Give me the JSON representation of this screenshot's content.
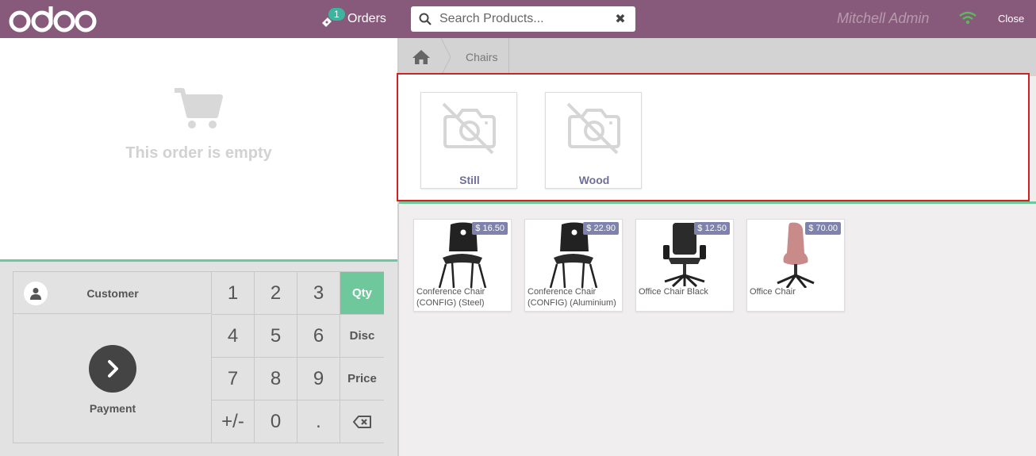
{
  "header": {
    "logo_text": "odoo",
    "orders_count": "1",
    "orders_label": "Orders",
    "search_placeholder": "Search Products...",
    "user_name": "Mitchell Admin",
    "close_label": "Close"
  },
  "order": {
    "empty_message": "This order is empty"
  },
  "pad": {
    "customer_label": "Customer",
    "payment_label": "Payment",
    "keys": [
      "1",
      "2",
      "3",
      "Qty",
      "4",
      "5",
      "6",
      "Disc",
      "7",
      "8",
      "9",
      "Price",
      "+/-",
      "0",
      "."
    ],
    "active_mode": "Qty"
  },
  "breadcrumb": {
    "home_icon": "home-icon",
    "current": "Chairs"
  },
  "categories": [
    {
      "name": "Still",
      "icon": "no-image-icon"
    },
    {
      "name": "Wood",
      "icon": "no-image-icon"
    }
  ],
  "products": [
    {
      "name": "Conference Chair (CONFIG) (Steel)",
      "price": "$ 16.50"
    },
    {
      "name": "Conference Chair (CONFIG) (Aluminium)",
      "price": "$ 22.90"
    },
    {
      "name": "Office Chair Black",
      "price": "$ 12.50"
    },
    {
      "name": "Office Chair",
      "price": "$ 70.00"
    }
  ],
  "colors": {
    "brand": "#875a7b",
    "accent": "#6ec89b",
    "price_tag": "#7f82ac",
    "highlight_border": "#d32020"
  }
}
